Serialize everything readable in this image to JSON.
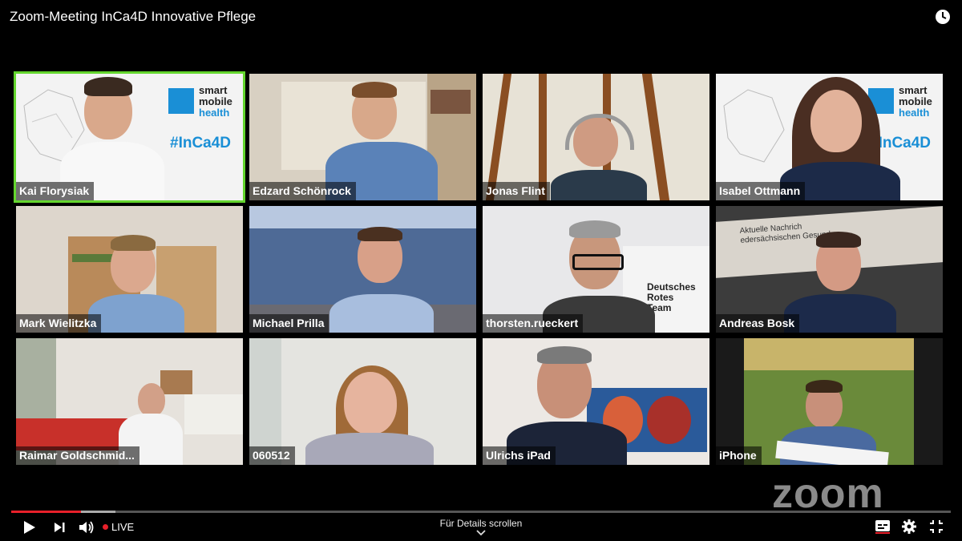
{
  "window": {
    "title": "Zoom-Meeting InCa4D Innovative Pflege"
  },
  "tiles": [
    {
      "name": "Kai Florysiak",
      "overlay": {
        "line1": "smart",
        "line2": "mobile",
        "line3": "health",
        "hashtag": "#InCa4D"
      }
    },
    {
      "name": "Edzard Schönrock"
    },
    {
      "name": "Jonas Flint"
    },
    {
      "name": "Isabel Ottmann",
      "overlay": {
        "line1": "smart",
        "line2": "mobile",
        "line3": "health",
        "hashtag": "#InCa4D"
      }
    },
    {
      "name": "Mark Wielitzka"
    },
    {
      "name": "Michael Prilla"
    },
    {
      "name": "thorsten.rueckert",
      "sign": [
        "Deutsches",
        "Rotes",
        "Team"
      ]
    },
    {
      "name": "Andreas Bosk",
      "banner": [
        "Aktuelle Nachrich",
        "edersächsischen Gesund"
      ]
    },
    {
      "name": "Raimar Goldschmid..."
    },
    {
      "name": "060512"
    },
    {
      "name": "Ulrichs iPad"
    },
    {
      "name": "iPhone"
    }
  ],
  "brand": {
    "watermark": "zoom"
  },
  "player": {
    "live_label": "LIVE",
    "scroll_hint": "Für Details scrollen",
    "progress_fraction": 0.074,
    "accent": "#e8202a"
  },
  "icons": [
    "clock-icon",
    "play-icon",
    "next-icon",
    "volume-icon",
    "subtitles-icon",
    "settings-icon",
    "exit-fullscreen-icon",
    "chevron-down-icon"
  ]
}
